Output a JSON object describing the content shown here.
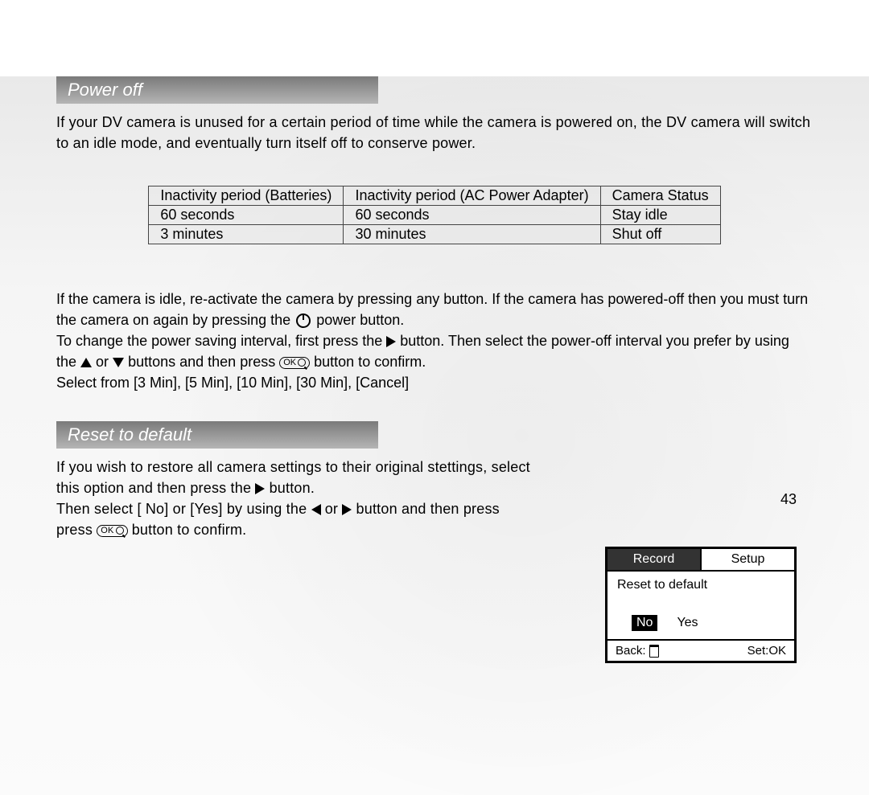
{
  "section1": {
    "title": "Power off",
    "intro": "If your DV camera is unused for a certain period of time while the camera is powered on, the DV camera will switch to an idle mode, and eventually turn itself off to conserve power."
  },
  "table": {
    "h1": "Inactivity period (Batteries)",
    "h2": "Inactivity period (AC Power Adapter)",
    "h3": "Camera Status",
    "r1c1": "60 seconds",
    "r1c2": "60 seconds",
    "r1c3": "Stay idle",
    "r2c1": "3 minutes",
    "r2c2": "30 minutes",
    "r2c3": "Shut off"
  },
  "body": {
    "p1a": "If the camera is idle, re-activate the camera by pressing any button. If the camera has powered-off then you must turn the camera on again by pressing the ",
    "p1b": " power button.",
    "p2a": "To change the power saving interval, first press the ",
    "p2b": " button. Then select the power-off interval you prefer by using the ",
    "p2c": " or ",
    "p2d": " buttons and then press ",
    "p2e": " button to confirm.",
    "p3": "Select from [3 Min], [5 Min], [10 Min], [30 Min], [Cancel]"
  },
  "section2": {
    "title": "Reset to default",
    "p1a": "If you wish to restore all camera settings to their original stettings, select this option and then press the ",
    "p1b": " button.",
    "p2a": "Then select [ No] or [Yes] by using the ",
    "p2b": " or ",
    "p2c": " button and then press ",
    "p2d": " button to confirm."
  },
  "lcd": {
    "tab_inactive": "Record",
    "tab_active": "Setup",
    "title": "Reset to default",
    "opt_no": "No",
    "opt_yes": "Yes",
    "back": "Back:",
    "set": "Set:OK"
  },
  "page_number": "43"
}
